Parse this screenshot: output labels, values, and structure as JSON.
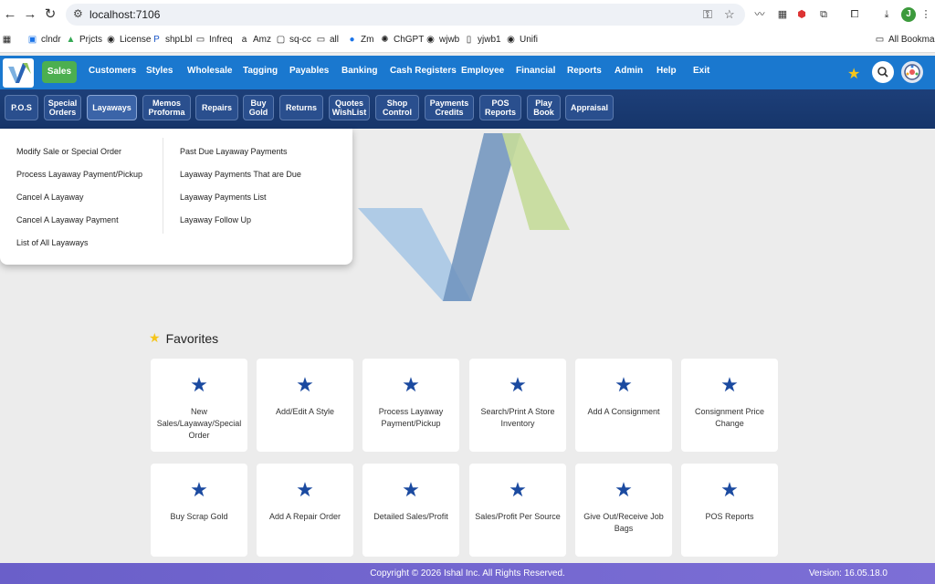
{
  "browser": {
    "url": "localhost:7106",
    "bookmarks": [
      "clndr",
      "Prjcts",
      "License",
      "shpLbl",
      "Infreq",
      "Amz",
      "sq-cc",
      "all",
      "Zm",
      "ChGPT",
      "wjwb",
      "yjwb1",
      "Unifi"
    ],
    "all_bookmarks": "All Bookmarks",
    "avatar_initial": "J"
  },
  "topmenu": {
    "items": [
      "Sales",
      "Customers",
      "Styles",
      "Wholesale",
      "Tagging",
      "Payables",
      "Banking",
      "Cash Registers",
      "Employee",
      "Financial",
      "Reports",
      "Admin",
      "Help",
      "Exit"
    ]
  },
  "submenu": {
    "items": [
      {
        "line1": "P.O.S",
        "line2": ""
      },
      {
        "line1": "Special",
        "line2": "Orders"
      },
      {
        "line1": "Layaways",
        "line2": ""
      },
      {
        "line1": "Memos",
        "line2": "Proforma"
      },
      {
        "line1": "Repairs",
        "line2": ""
      },
      {
        "line1": "Buy",
        "line2": "Gold"
      },
      {
        "line1": "Returns",
        "line2": ""
      },
      {
        "line1": "Quotes",
        "line2": "WishList"
      },
      {
        "line1": "Shop",
        "line2": "Control"
      },
      {
        "line1": "Payments",
        "line2": "Credits"
      },
      {
        "line1": "POS",
        "line2": "Reports"
      },
      {
        "line1": "Play",
        "line2": "Book"
      },
      {
        "line1": "Appraisal",
        "line2": ""
      }
    ]
  },
  "dropdown": {
    "left": [
      "Modify Sale or Special Order",
      "Process Layaway Payment/Pickup",
      "Cancel A Layaway",
      "Cancel A Layaway Payment",
      "List of All Layaways"
    ],
    "right": [
      "Past Due Layaway Payments",
      "Layaway Payments That are Due",
      "Layaway Payments List",
      "Layaway Follow Up"
    ]
  },
  "favorites": {
    "title": "Favorites",
    "tiles": [
      "New Sales/Layaway/Special Order",
      "Add/Edit A Style",
      "Process Layaway Payment/Pickup",
      "Search/Print A Store Inventory",
      "Add A Consignment",
      "Consignment Price Change",
      "Buy Scrap Gold",
      "Add A Repair Order",
      "Detailed Sales/Profit",
      "Sales/Profit Per Source",
      "Give Out/Receive Job Bags",
      "POS Reports"
    ]
  },
  "footer": {
    "copyright": "Copyright © 2026 Ishal Inc. All Rights Reserved.",
    "version": "Version: 16.05.18.0"
  },
  "colors": {
    "appbar": "#1a78cf",
    "subbar": "#1d3f79",
    "active_menu": "#4caf50",
    "star": "#1b4aa0",
    "footer": "#7064cf"
  }
}
